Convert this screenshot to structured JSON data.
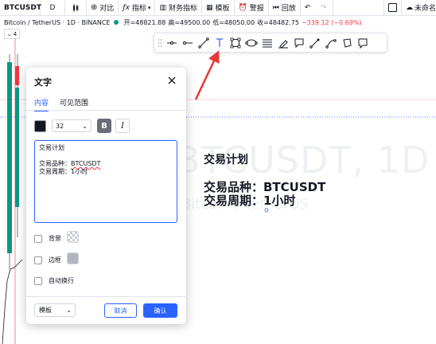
{
  "topbar": {
    "symbol": "BTCUSDT",
    "interval": "D",
    "compare": "对比",
    "indicators": "指标",
    "financials": "财务指标",
    "templates": "模板",
    "alert": "警报",
    "replay": "回放",
    "unnamed": "未命名"
  },
  "infobar": {
    "pair": "Bitcoin / TetherUS · 1D · BINANCE",
    "open": "开=48821.88",
    "high": "高=49500.00",
    "low": "低=48050.00",
    "close": "收=48482.75",
    "change": "−339.12 (−0.69%)"
  },
  "collapse_label": "⌄ 4",
  "chart": {
    "text_line1": "交易计划",
    "text_line2": "交易品种：BTCUSDT",
    "text_line3": "交易周期：1小时",
    "watermark": "BTCUSDT, 1D",
    "watermark_sub": "Bitcoin / TetherUS",
    "colors": {
      "up": "#089981",
      "down": "#f23645",
      "accent": "#2962ff"
    }
  },
  "toolbar": {
    "icons": [
      "drag-handle-icon",
      "horizontal-ray-icon",
      "horizontal-line-icon",
      "trend-line-icon",
      "text-tool-icon",
      "rectangle-icon",
      "ellipse-icon",
      "lines-icon",
      "brush-icon",
      "callout-icon",
      "arrow-marker-icon",
      "path-icon",
      "polygon-icon",
      "note-icon"
    ]
  },
  "dialog": {
    "title": "文字",
    "tab_content": "内容",
    "tab_visibility": "可见范围",
    "font_size": "32",
    "bold_label": "B",
    "italic_label": "I",
    "text_line1": "交易计划",
    "text_line2_prefix": "交易品种：",
    "text_line2_value": "BTCUSDT",
    "text_line3": "交易周期：1小时",
    "background_label": "背景",
    "border_label": "边框",
    "wrap_label": "自动换行",
    "template_label": "模板",
    "cancel_label": "取消",
    "ok_label": "确认"
  }
}
